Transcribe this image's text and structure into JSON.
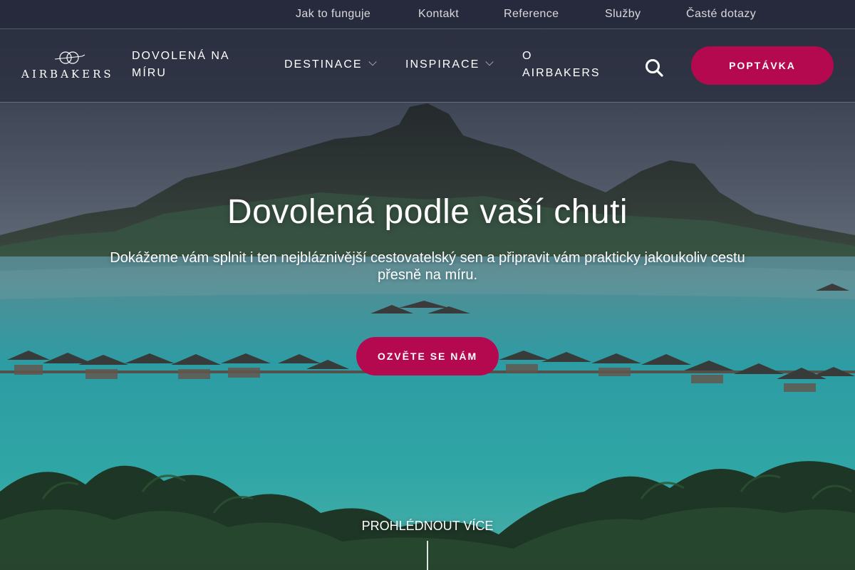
{
  "topbar": {
    "links": [
      "Jak to funguje",
      "Kontakt",
      "Reference",
      "Služby",
      "Časté dotazy"
    ]
  },
  "nav": {
    "logo_text": "AIRBAKERS",
    "items": [
      {
        "label": "DOVOLENÁ NA MÍRU",
        "has_dropdown": false
      },
      {
        "label": "DESTINACE",
        "has_dropdown": true
      },
      {
        "label": "INSPIRACE",
        "has_dropdown": true
      },
      {
        "label": "O AIRBAKERS",
        "has_dropdown": false
      }
    ],
    "search_icon": "search-icon",
    "cta_label": "POPTÁVKA"
  },
  "hero": {
    "title": "Dovolená podle vaší chuti",
    "subtitle": "Dokážeme vám splnit i ten nejbláznivější cestovatelský sen a připravit vám prakticky jakoukoliv cestu přesně na míru.",
    "cta_label": "OZVĚTE SE NÁM",
    "more_label": "PROHLÉDNOUT VÍCE"
  },
  "colors": {
    "accent": "#b5094f",
    "nav_background": "#2a2e40"
  }
}
